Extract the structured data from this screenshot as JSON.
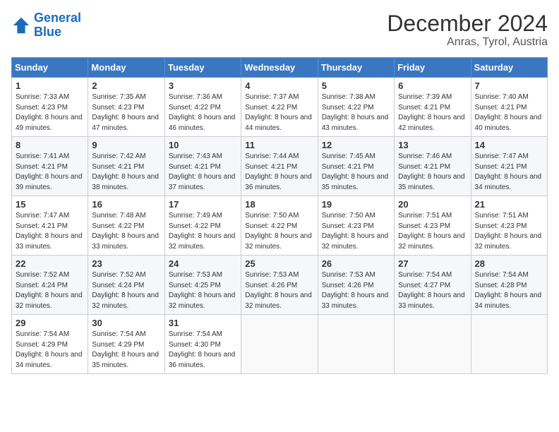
{
  "header": {
    "logo_line1": "General",
    "logo_line2": "Blue",
    "title": "December 2024",
    "subtitle": "Anras, Tyrol, Austria"
  },
  "weekdays": [
    "Sunday",
    "Monday",
    "Tuesday",
    "Wednesday",
    "Thursday",
    "Friday",
    "Saturday"
  ],
  "weeks": [
    [
      {
        "day": "1",
        "sunrise": "Sunrise: 7:33 AM",
        "sunset": "Sunset: 4:23 PM",
        "daylight": "Daylight: 8 hours and 49 minutes."
      },
      {
        "day": "2",
        "sunrise": "Sunrise: 7:35 AM",
        "sunset": "Sunset: 4:23 PM",
        "daylight": "Daylight: 8 hours and 47 minutes."
      },
      {
        "day": "3",
        "sunrise": "Sunrise: 7:36 AM",
        "sunset": "Sunset: 4:22 PM",
        "daylight": "Daylight: 8 hours and 46 minutes."
      },
      {
        "day": "4",
        "sunrise": "Sunrise: 7:37 AM",
        "sunset": "Sunset: 4:22 PM",
        "daylight": "Daylight: 8 hours and 44 minutes."
      },
      {
        "day": "5",
        "sunrise": "Sunrise: 7:38 AM",
        "sunset": "Sunset: 4:22 PM",
        "daylight": "Daylight: 8 hours and 43 minutes."
      },
      {
        "day": "6",
        "sunrise": "Sunrise: 7:39 AM",
        "sunset": "Sunset: 4:21 PM",
        "daylight": "Daylight: 8 hours and 42 minutes."
      },
      {
        "day": "7",
        "sunrise": "Sunrise: 7:40 AM",
        "sunset": "Sunset: 4:21 PM",
        "daylight": "Daylight: 8 hours and 40 minutes."
      }
    ],
    [
      {
        "day": "8",
        "sunrise": "Sunrise: 7:41 AM",
        "sunset": "Sunset: 4:21 PM",
        "daylight": "Daylight: 8 hours and 39 minutes."
      },
      {
        "day": "9",
        "sunrise": "Sunrise: 7:42 AM",
        "sunset": "Sunset: 4:21 PM",
        "daylight": "Daylight: 8 hours and 38 minutes."
      },
      {
        "day": "10",
        "sunrise": "Sunrise: 7:43 AM",
        "sunset": "Sunset: 4:21 PM",
        "daylight": "Daylight: 8 hours and 37 minutes."
      },
      {
        "day": "11",
        "sunrise": "Sunrise: 7:44 AM",
        "sunset": "Sunset: 4:21 PM",
        "daylight": "Daylight: 8 hours and 36 minutes."
      },
      {
        "day": "12",
        "sunrise": "Sunrise: 7:45 AM",
        "sunset": "Sunset: 4:21 PM",
        "daylight": "Daylight: 8 hours and 35 minutes."
      },
      {
        "day": "13",
        "sunrise": "Sunrise: 7:46 AM",
        "sunset": "Sunset: 4:21 PM",
        "daylight": "Daylight: 8 hours and 35 minutes."
      },
      {
        "day": "14",
        "sunrise": "Sunrise: 7:47 AM",
        "sunset": "Sunset: 4:21 PM",
        "daylight": "Daylight: 8 hours and 34 minutes."
      }
    ],
    [
      {
        "day": "15",
        "sunrise": "Sunrise: 7:47 AM",
        "sunset": "Sunset: 4:21 PM",
        "daylight": "Daylight: 8 hours and 33 minutes."
      },
      {
        "day": "16",
        "sunrise": "Sunrise: 7:48 AM",
        "sunset": "Sunset: 4:22 PM",
        "daylight": "Daylight: 8 hours and 33 minutes."
      },
      {
        "day": "17",
        "sunrise": "Sunrise: 7:49 AM",
        "sunset": "Sunset: 4:22 PM",
        "daylight": "Daylight: 8 hours and 32 minutes."
      },
      {
        "day": "18",
        "sunrise": "Sunrise: 7:50 AM",
        "sunset": "Sunset: 4:22 PM",
        "daylight": "Daylight: 8 hours and 32 minutes."
      },
      {
        "day": "19",
        "sunrise": "Sunrise: 7:50 AM",
        "sunset": "Sunset: 4:23 PM",
        "daylight": "Daylight: 8 hours and 32 minutes."
      },
      {
        "day": "20",
        "sunrise": "Sunrise: 7:51 AM",
        "sunset": "Sunset: 4:23 PM",
        "daylight": "Daylight: 8 hours and 32 minutes."
      },
      {
        "day": "21",
        "sunrise": "Sunrise: 7:51 AM",
        "sunset": "Sunset: 4:23 PM",
        "daylight": "Daylight: 8 hours and 32 minutes."
      }
    ],
    [
      {
        "day": "22",
        "sunrise": "Sunrise: 7:52 AM",
        "sunset": "Sunset: 4:24 PM",
        "daylight": "Daylight: 8 hours and 32 minutes."
      },
      {
        "day": "23",
        "sunrise": "Sunrise: 7:52 AM",
        "sunset": "Sunset: 4:24 PM",
        "daylight": "Daylight: 8 hours and 32 minutes."
      },
      {
        "day": "24",
        "sunrise": "Sunrise: 7:53 AM",
        "sunset": "Sunset: 4:25 PM",
        "daylight": "Daylight: 8 hours and 32 minutes."
      },
      {
        "day": "25",
        "sunrise": "Sunrise: 7:53 AM",
        "sunset": "Sunset: 4:26 PM",
        "daylight": "Daylight: 8 hours and 32 minutes."
      },
      {
        "day": "26",
        "sunrise": "Sunrise: 7:53 AM",
        "sunset": "Sunset: 4:26 PM",
        "daylight": "Daylight: 8 hours and 33 minutes."
      },
      {
        "day": "27",
        "sunrise": "Sunrise: 7:54 AM",
        "sunset": "Sunset: 4:27 PM",
        "daylight": "Daylight: 8 hours and 33 minutes."
      },
      {
        "day": "28",
        "sunrise": "Sunrise: 7:54 AM",
        "sunset": "Sunset: 4:28 PM",
        "daylight": "Daylight: 8 hours and 34 minutes."
      }
    ],
    [
      {
        "day": "29",
        "sunrise": "Sunrise: 7:54 AM",
        "sunset": "Sunset: 4:29 PM",
        "daylight": "Daylight: 8 hours and 34 minutes."
      },
      {
        "day": "30",
        "sunrise": "Sunrise: 7:54 AM",
        "sunset": "Sunset: 4:29 PM",
        "daylight": "Daylight: 8 hours and 35 minutes."
      },
      {
        "day": "31",
        "sunrise": "Sunrise: 7:54 AM",
        "sunset": "Sunset: 4:30 PM",
        "daylight": "Daylight: 8 hours and 36 minutes."
      },
      null,
      null,
      null,
      null
    ]
  ]
}
